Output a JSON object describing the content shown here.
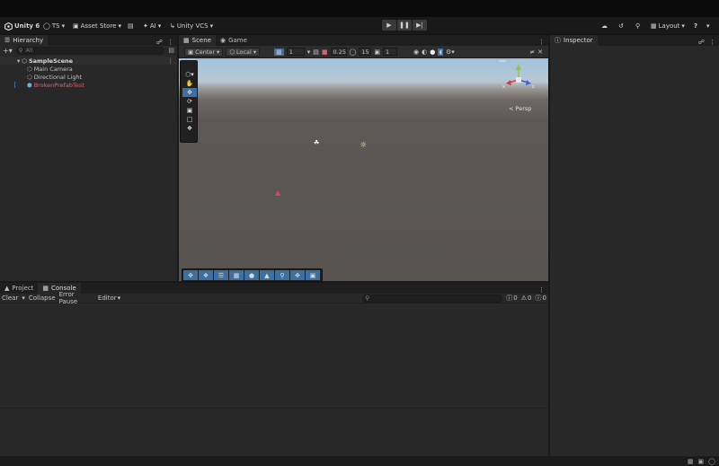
{
  "toolbar": {
    "unity_label": "Unity 6",
    "account_label": "TS",
    "asset_store_label": "Asset Store",
    "ai_label": "AI",
    "vcs_label": "Unity VCS",
    "layout_label": "Layout"
  },
  "hierarchy": {
    "tab_label": "Hierarchy",
    "search_placeholder": "All",
    "scene_name": "SampleScene",
    "objects": [
      {
        "name": "Main Camera",
        "color": "#c4c4c4"
      },
      {
        "name": "Directional Light",
        "color": "#c4c4c4"
      },
      {
        "name": "BrokenPrefabTest",
        "color": "#e0606a"
      }
    ]
  },
  "scene": {
    "tabs": [
      "Scene",
      "Game"
    ],
    "pivot_label": "Center",
    "space_label": "Local",
    "grid_value": "1",
    "snap_value": "0.25",
    "angle_value": "15",
    "scale_value": "1",
    "persp_label": "< Persp"
  },
  "inspector": {
    "tab_label": "Inspector"
  },
  "console": {
    "tabs": [
      "Project",
      "Console"
    ],
    "clear_label": "Clear",
    "collapse_label": "Collapse",
    "error_pause_label": "Error Pause",
    "editor_label": "Editor",
    "error_count": "0",
    "warning_count": "0",
    "log_count": "0"
  },
  "colors": {
    "accent": "#3d6fa1",
    "error_object": "#e0606a"
  }
}
